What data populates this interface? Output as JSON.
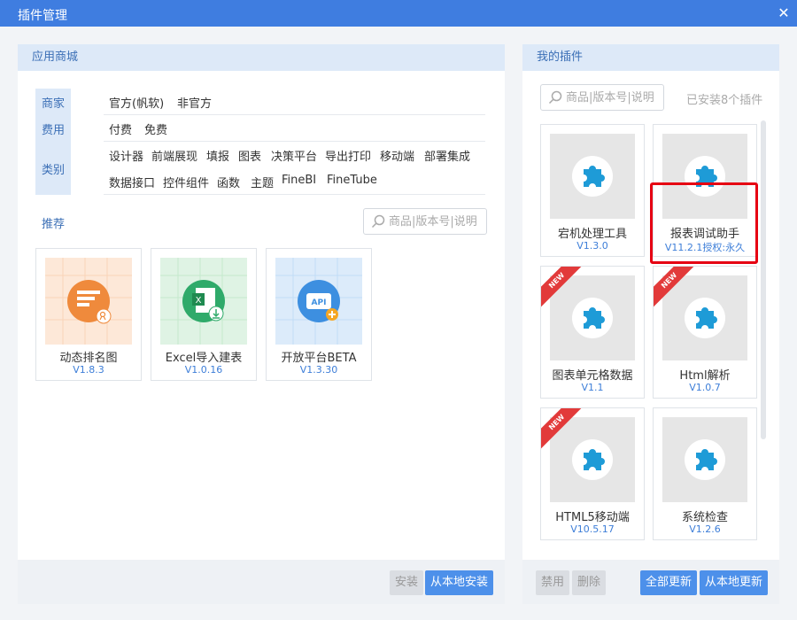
{
  "window": {
    "title": "插件管理",
    "close_glyph": "✕"
  },
  "store": {
    "header": "应用商城",
    "tabs": [
      "商家",
      "费用",
      "类别"
    ],
    "merchant_options": [
      "官方(帆软)",
      "非官方"
    ],
    "fee_options": [
      "付费",
      "免费"
    ],
    "category_options_row1": [
      "设计器",
      "前端展现",
      "填报",
      "图表",
      "决策平台",
      "导出打印",
      "移动端",
      "部署集成"
    ],
    "category_options_row2": [
      "数据接口",
      "控件组件",
      "函数",
      "主题",
      "FineBI",
      "FineTube"
    ],
    "recommend_label": "推荐",
    "search_placeholder": "商品|版本号|说明",
    "recommended": [
      {
        "name": "动态排名图",
        "version": "V1.8.3",
        "icon": "ranking-chart-icon",
        "accent": "#ef8a3c"
      },
      {
        "name": "Excel导入建表",
        "version": "V1.0.16",
        "icon": "excel-import-icon",
        "accent": "#2faa6a"
      },
      {
        "name": "开放平台BETA",
        "version": "V1.3.30",
        "icon": "api-platform-icon",
        "accent": "#3d8fe0"
      }
    ],
    "buttons": {
      "install": "安装",
      "install_local": "从本地安装"
    }
  },
  "mine": {
    "header": "我的插件",
    "search_placeholder": "商品|版本号|说明",
    "installed_count": "已安装8个插件",
    "plugins": [
      {
        "name": "宕机处理工具",
        "version": "V1.3.0",
        "new": false
      },
      {
        "name": "报表调试助手",
        "version": "V11.2.1授权:永久",
        "new": false
      },
      {
        "name": "图表单元格数据",
        "version": "V1.1",
        "new": true
      },
      {
        "name": "Html解析",
        "version": "V1.0.7",
        "new": true
      },
      {
        "name": "HTML5移动端",
        "version": "V10.5.17",
        "new": true
      },
      {
        "name": "系统检查",
        "version": "V1.2.6",
        "new": false
      }
    ],
    "new_badge": "NEW",
    "buttons": {
      "disable": "禁用",
      "delete": "删除",
      "update_all": "全部更新",
      "update_local": "从本地更新"
    }
  },
  "colors": {
    "titlebar": "#3f7de0",
    "accent_blue": "#4d90ea",
    "highlight_red": "#e60012",
    "puzzle": "#1e9bd7"
  }
}
